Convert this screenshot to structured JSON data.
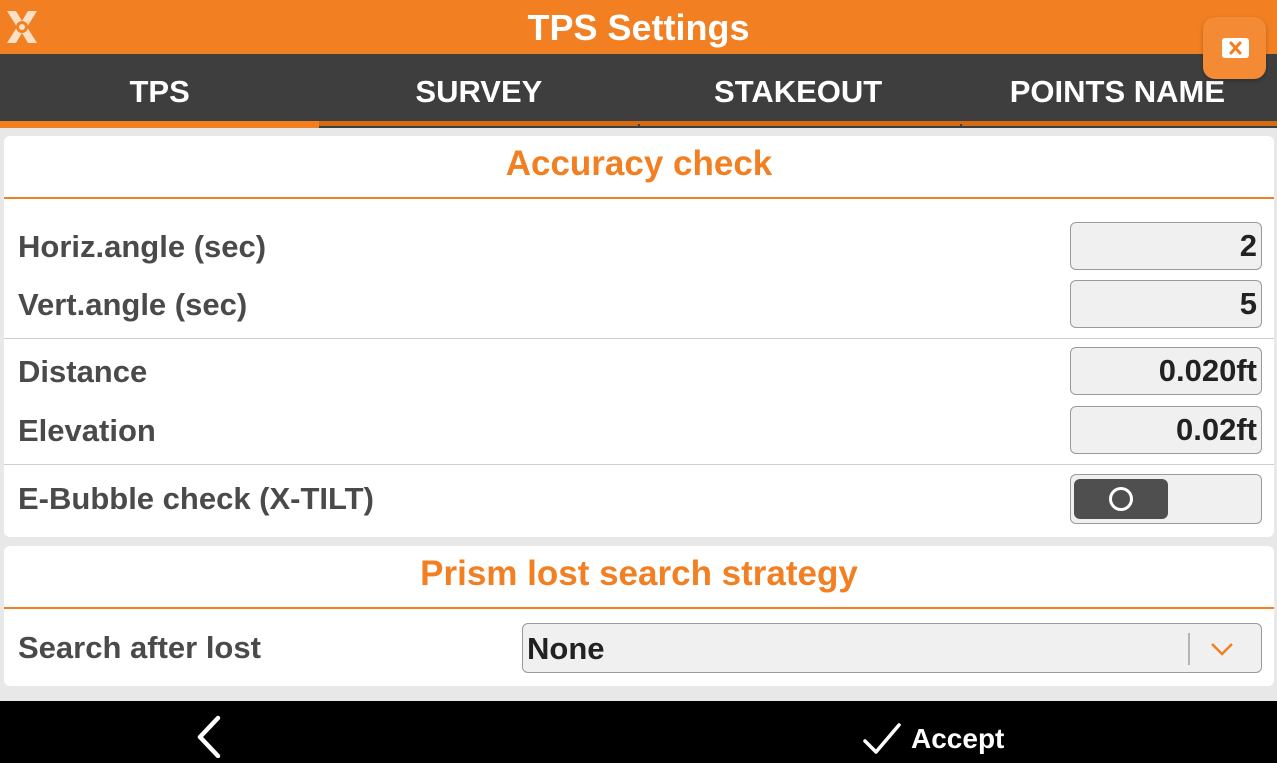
{
  "titlebar": {
    "title": "TPS Settings",
    "logo_icon": "app-logo-icon",
    "close_icon": "close-icon"
  },
  "tabs": [
    {
      "label": "TPS",
      "active": true
    },
    {
      "label": "SURVEY",
      "active": false
    },
    {
      "label": "STAKEOUT",
      "active": false
    },
    {
      "label": "POINTS NAME",
      "active": false
    }
  ],
  "accuracy": {
    "title": "Accuracy check",
    "horiz_label": "Horiz.angle (sec)",
    "horiz_value": "2",
    "vert_label": "Vert.angle (sec)",
    "vert_value": "5",
    "distance_label": "Distance",
    "distance_value": "0.020ft",
    "elevation_label": "Elevation",
    "elevation_value": "0.02ft",
    "ebubble_label": "E-Bubble check (X-TILT)",
    "ebubble_on": false
  },
  "prism": {
    "title": "Prism lost search strategy",
    "search_label": "Search after lost",
    "search_value": "None"
  },
  "bottombar": {
    "back_icon": "back-arrow-icon",
    "accept_icon": "checkmark-icon",
    "accept_label": "Accept"
  },
  "colors": {
    "accent": "#f27f22",
    "tabbar": "#3e3e3e",
    "bottombar": "#000000"
  }
}
